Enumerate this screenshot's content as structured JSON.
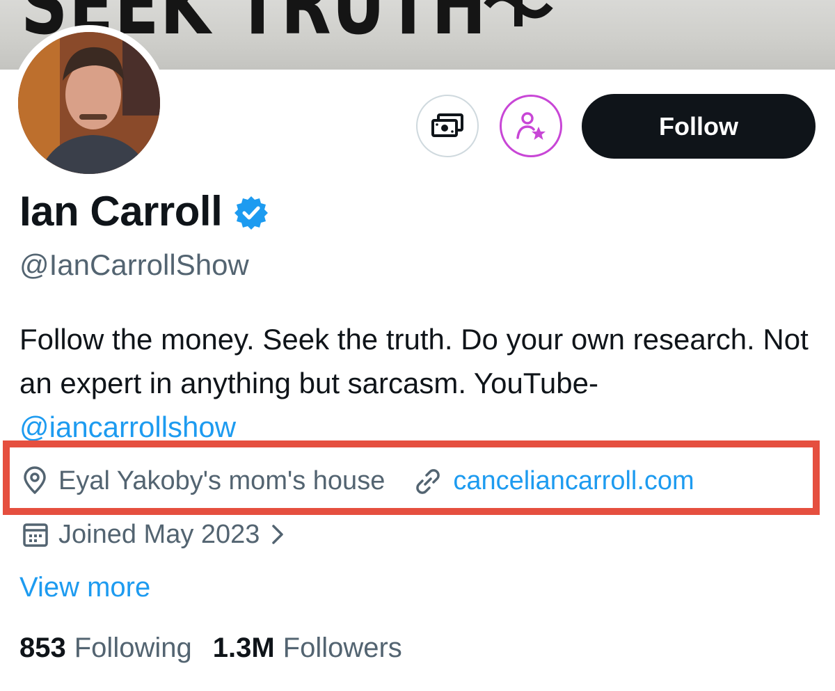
{
  "banner": {
    "text": "SEEK TRUTH"
  },
  "profile": {
    "display_name": "Ian Carroll",
    "handle": "@IanCarrollShow",
    "bio_text": "Follow the money. Seek the truth. Do your own research. Not an expert in anything but sarcasm. YouTube- ",
    "bio_mention": "@iancarrollshow",
    "location": "Eyal Yakoby's mom's house",
    "website": "canceliancarroll.com",
    "joined": "Joined May 2023",
    "view_more": "View more"
  },
  "actions": {
    "follow_label": "Follow"
  },
  "stats": {
    "following_count": "853",
    "following_label": "Following",
    "followers_count": "1.3M",
    "followers_label": "Followers"
  },
  "icons": {
    "tip": "money-icon",
    "subscribe": "subscribe-star-icon",
    "verified": "verified-badge-icon",
    "location": "location-pin-icon",
    "link": "link-icon",
    "calendar": "calendar-icon"
  },
  "colors": {
    "accent": "#1d9bf0",
    "subscribe": "#c846d6",
    "highlight": "#e54f3f",
    "text_primary": "#0f1419",
    "text_secondary": "#536471"
  }
}
